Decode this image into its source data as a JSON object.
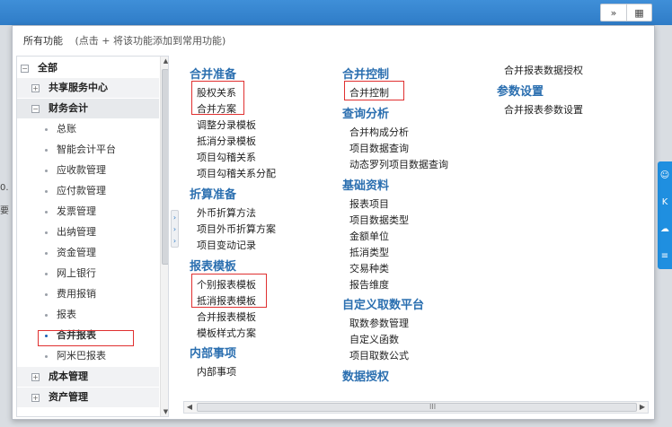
{
  "topbar": {
    "icon_expand": "»",
    "icon_grid": "▦"
  },
  "background": {
    "snippet_number": "0.",
    "snippet_text": "要"
  },
  "popup": {
    "title": "所有功能",
    "hint": "(点击 + 将该功能添加到常用功能)"
  },
  "tree": {
    "root": "全部",
    "groups": [
      {
        "label": "共享服务中心",
        "expanded": false
      },
      {
        "label": "财务会计",
        "expanded": true,
        "children": [
          "总账",
          "智能会计平台",
          "应收款管理",
          "应付款管理",
          "发票管理",
          "出纳管理",
          "资金管理",
          "网上银行",
          "费用报销",
          "报表",
          "合并报表",
          "阿米巴报表"
        ],
        "selected": "合并报表"
      },
      {
        "label": "成本管理",
        "expanded": false
      },
      {
        "label": "资产管理",
        "expanded": false
      }
    ],
    "expand_symbol": "+",
    "collapse_symbol": "−"
  },
  "content": {
    "col1": {
      "c1": {
        "title": "合并准备",
        "items": [
          "股权关系",
          "合并方案",
          "调整分录模板",
          "抵消分录模板",
          "项目勾稽关系",
          "项目勾稽关系分配"
        ]
      },
      "c2": {
        "title": "折算准备",
        "items": [
          "外币折算方法",
          "项目外币折算方案",
          "项目变动记录"
        ]
      },
      "c3": {
        "title": "报表模板",
        "items": [
          "个别报表模板",
          "抵消报表模板",
          "合并报表模板",
          "模板样式方案"
        ]
      },
      "c4": {
        "title": "内部事项",
        "items": [
          "内部事项"
        ]
      }
    },
    "col2": {
      "c1": {
        "title": "合并控制",
        "items": [
          "合并控制"
        ]
      },
      "c2": {
        "title": "查询分析",
        "items": [
          "合并构成分析",
          "项目数据查询",
          "动态罗列项目数据查询"
        ]
      },
      "c3": {
        "title": "基础资料",
        "items": [
          "报表项目",
          "项目数据类型",
          "金额单位",
          "抵消类型",
          "交易种类",
          "报告维度"
        ]
      },
      "c4": {
        "title": "自定义取数平台",
        "items": [
          "取数参数管理",
          "自定义函数",
          "项目取数公式"
        ]
      },
      "c5": {
        "title": "数据授权",
        "items": []
      }
    },
    "col3": {
      "top_item": "合并报表数据授权",
      "c1": {
        "title": "参数设置",
        "items": [
          "合并报表参数设置"
        ]
      }
    }
  },
  "scroll": {
    "left": "◀",
    "right": "▶",
    "up": "▲",
    "down": "▼",
    "grip": "III"
  },
  "right_rail_icons": [
    "robot-icon",
    "k-icon",
    "cloud-icon",
    "database-icon"
  ],
  "colors": {
    "accent": "#2b6fb0",
    "highlight": "#e03030",
    "topbar": "#2f7cc7"
  }
}
